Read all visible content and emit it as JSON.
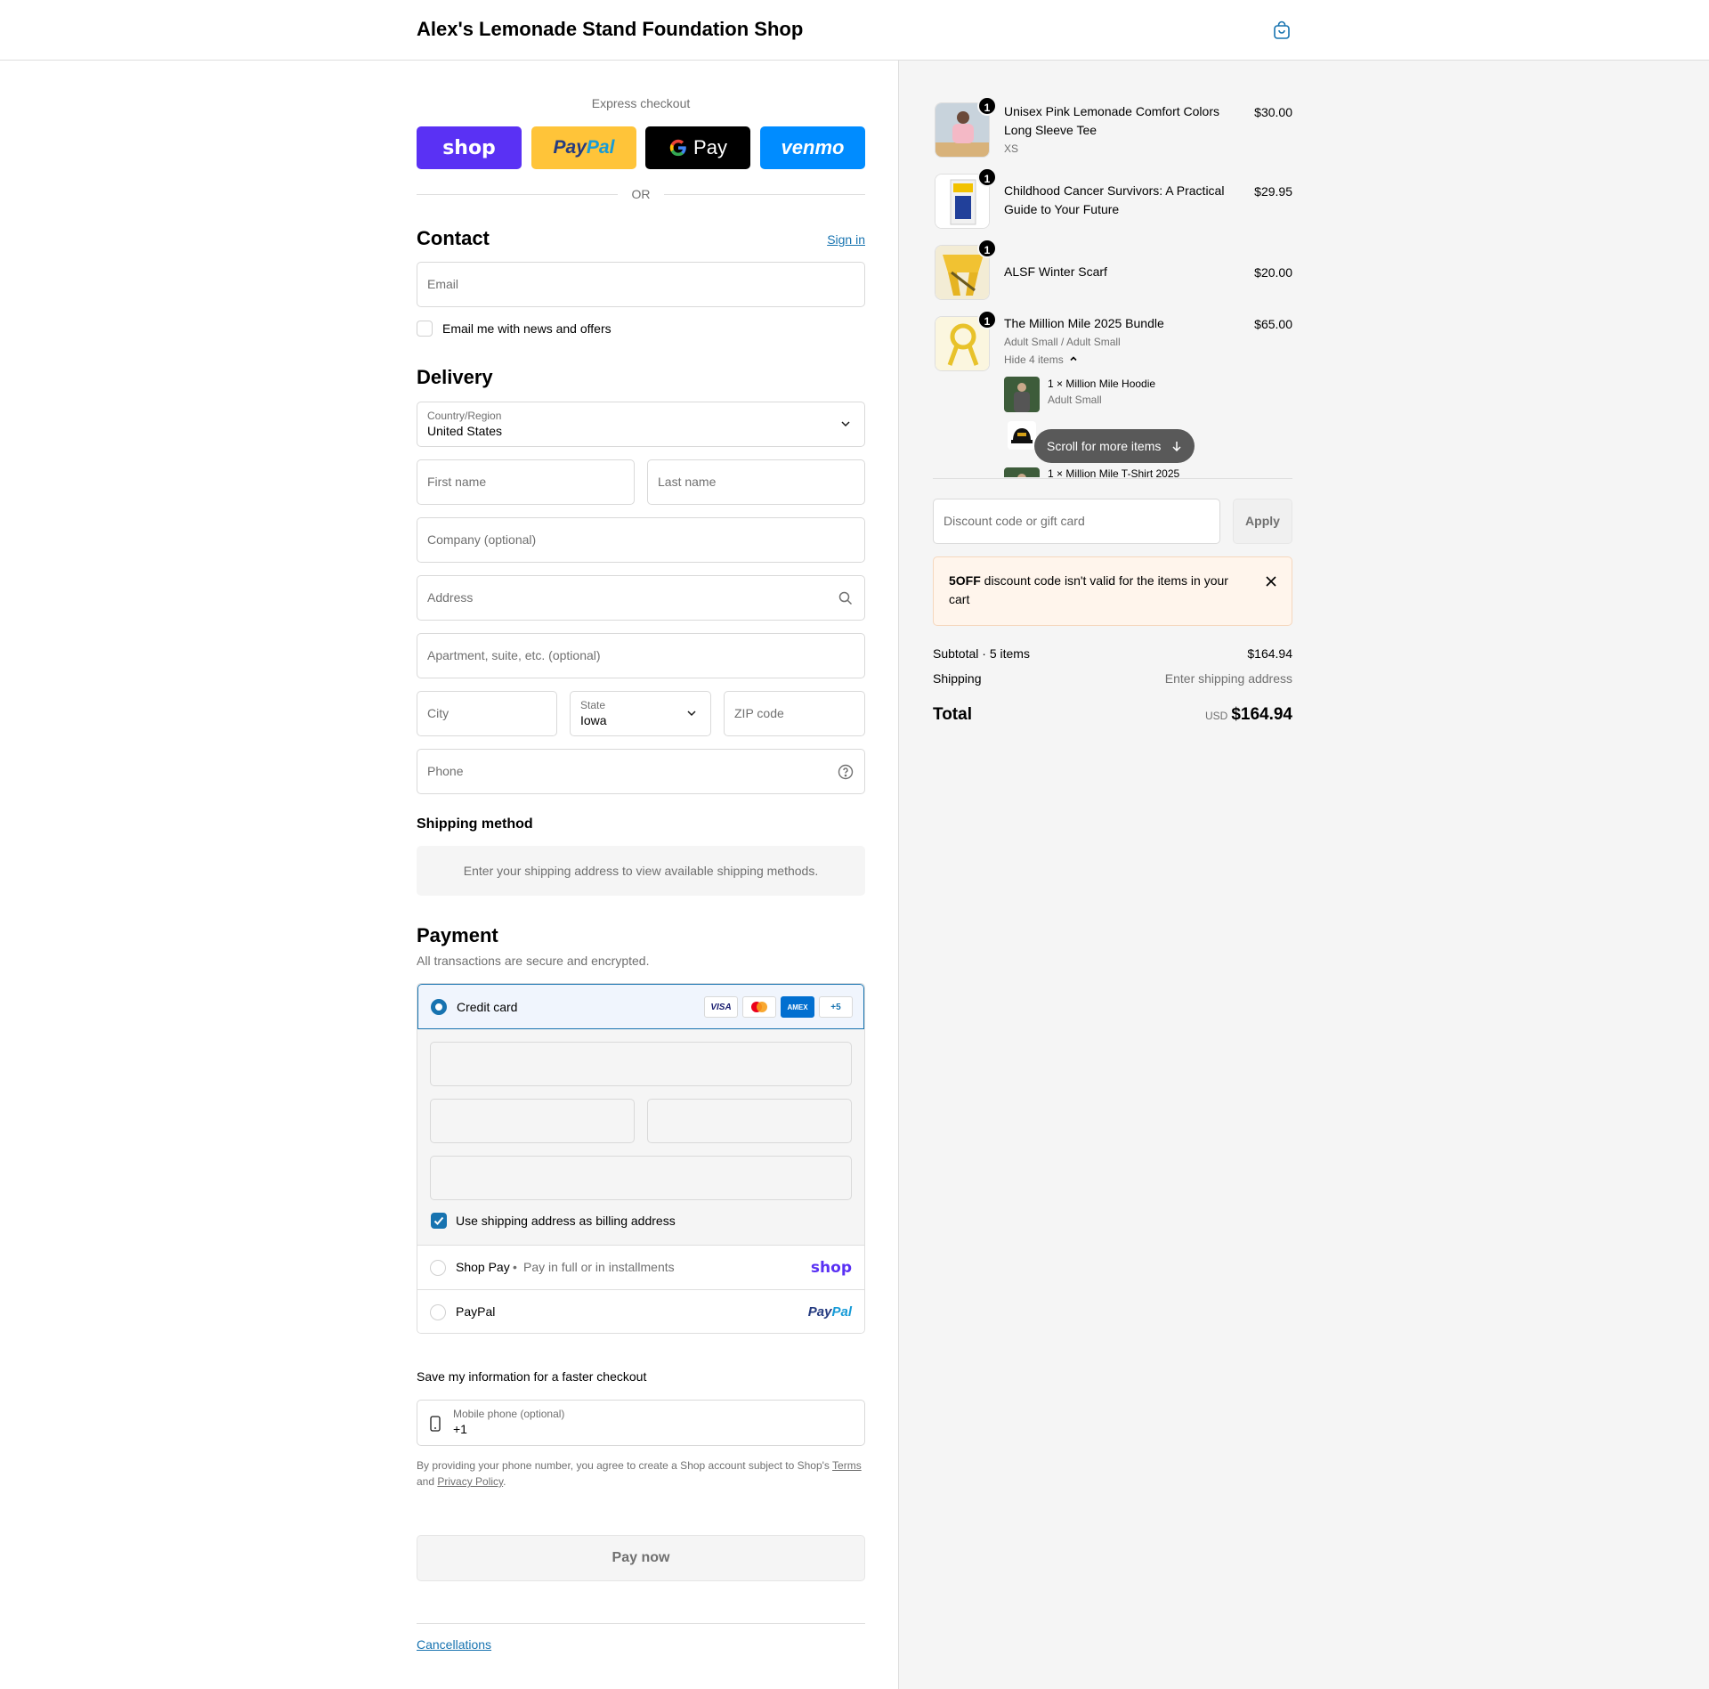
{
  "header": {
    "shop_name": "Alex's Lemonade Stand Foundation Shop"
  },
  "express": {
    "label": "Express checkout",
    "shop_label": "shop",
    "paypal_pay": "Pay",
    "paypal_pal": "Pal",
    "gpay_label": "Pay",
    "venmo_label": "venmo",
    "or": "OR"
  },
  "contact": {
    "title": "Contact",
    "sign_in": "Sign in",
    "email_placeholder": "Email",
    "news_label": "Email me with news and offers"
  },
  "delivery": {
    "title": "Delivery",
    "country_label": "Country/Region",
    "country_value": "United States",
    "first_name": "First name",
    "last_name": "Last name",
    "company": "Company (optional)",
    "address": "Address",
    "apartment": "Apartment, suite, etc. (optional)",
    "city": "City",
    "state_label": "State",
    "state_value": "Iowa",
    "zip": "ZIP code",
    "phone": "Phone"
  },
  "shipping_method": {
    "title": "Shipping method",
    "message": "Enter your shipping address to view available shipping methods."
  },
  "payment": {
    "title": "Payment",
    "subtitle": "All transactions are secure and encrypted.",
    "credit_card": "Credit card",
    "card_badges": [
      "VISA",
      "",
      "AMEX",
      "+5"
    ],
    "billing_same": "Use shipping address as billing address",
    "shop_pay": "Shop Pay",
    "shop_pay_sep": "•",
    "shop_pay_desc": "Pay in full or in installments",
    "shop_pay_logo": "shop",
    "paypal": "PayPal",
    "paypal_logo_pay": "Pay",
    "paypal_logo_pal": "Pal"
  },
  "save_info": {
    "title": "Save my information for a faster checkout",
    "phone_label": "Mobile phone (optional)",
    "phone_value": "+1",
    "legal_prefix": "By providing your phone number, you agree to create a Shop account subject to Shop's",
    "terms": "Terms",
    "legal_and": "and",
    "privacy": "Privacy Policy",
    "legal_end": "."
  },
  "pay_now": "Pay now",
  "footer": {
    "cancellations": "Cancellations"
  },
  "cart": {
    "items": [
      {
        "name": "Unisex Pink Lemonade Comfort Colors Long Sleeve Tee",
        "variant": "XS",
        "price": "$30.00",
        "qty": "1"
      },
      {
        "name": "Childhood Cancer Survivors: A Practical Guide to Your Future",
        "variant": "",
        "price": "$29.95",
        "qty": "1"
      },
      {
        "name": "ALSF Winter Scarf",
        "variant": "",
        "price": "$20.00",
        "qty": "1"
      },
      {
        "name": "The Million Mile 2025 Bundle",
        "variant": "Adult Small / Adult Small",
        "price": "$65.00",
        "qty": "1"
      }
    ],
    "hide_items": "Hide 4 items",
    "bundle_items": [
      {
        "name": "1 × Million Mile Hoodie",
        "variant": "Adult Small"
      },
      {
        "name": "1 × Million Mile T-Shirt 2025",
        "variant": ""
      }
    ],
    "scroll_hint": "Scroll for more items"
  },
  "discount": {
    "placeholder": "Discount code or gift card",
    "apply": "Apply",
    "error_code": "5OFF",
    "error_text": " discount code isn't valid for the items in your cart"
  },
  "totals": {
    "subtotal_label": "Subtotal · 5 items",
    "subtotal_value": "$164.94",
    "shipping_label": "Shipping",
    "shipping_value": "Enter shipping address",
    "total_label": "Total",
    "currency": "USD",
    "total_value": "$164.94"
  },
  "colors": {
    "accent": "#1773b0",
    "shop_pay": "#5a31f4",
    "venmo": "#008cff",
    "paypal": "#ffc439"
  }
}
